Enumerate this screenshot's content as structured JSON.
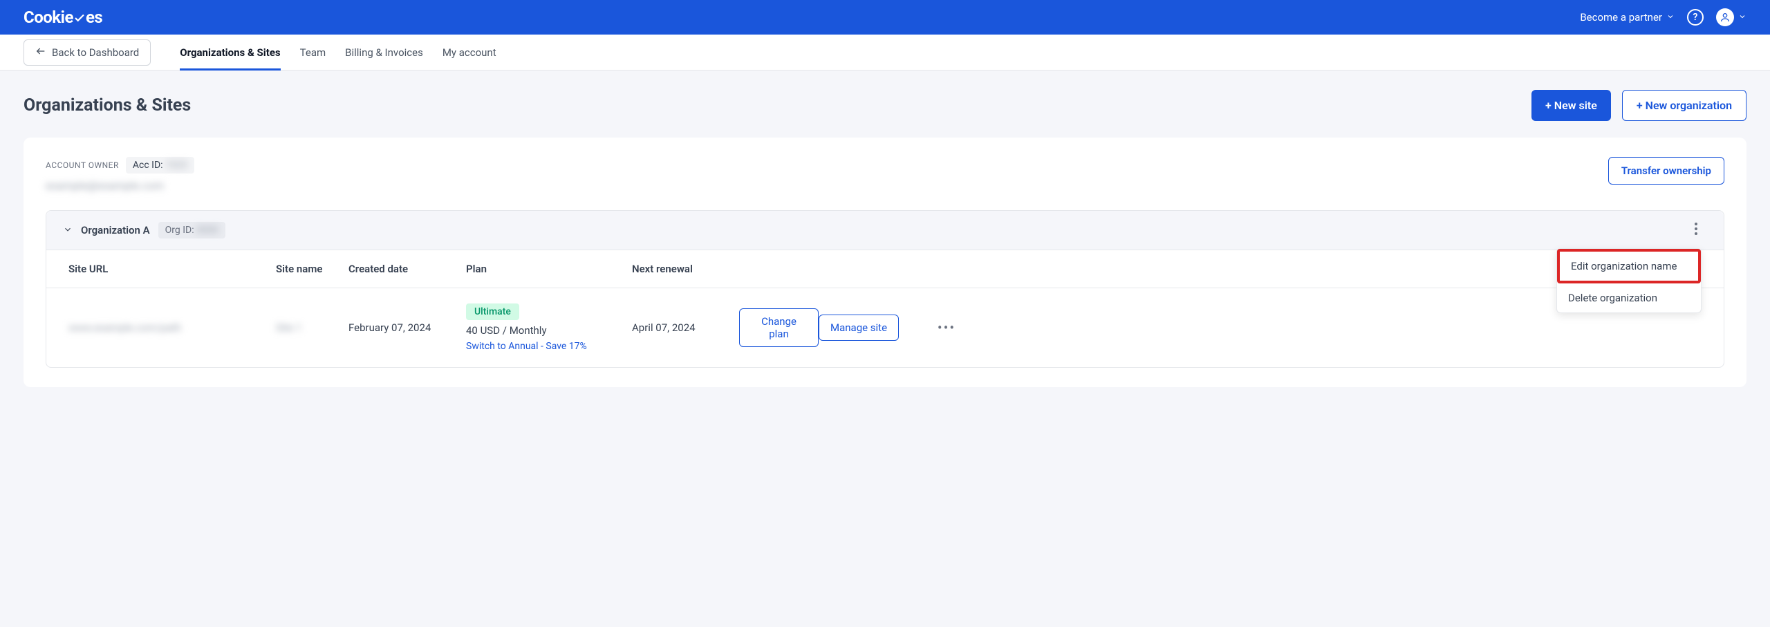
{
  "header": {
    "logo": "CookieYes",
    "partner_label": "Become a partner",
    "help_icon_text": "?"
  },
  "nav": {
    "back_label": "Back to Dashboard",
    "tabs": [
      {
        "label": "Organizations & Sites",
        "active": true
      },
      {
        "label": "Team",
        "active": false
      },
      {
        "label": "Billing & Invoices",
        "active": false
      },
      {
        "label": "My account",
        "active": false
      }
    ]
  },
  "page": {
    "title": "Organizations & Sites",
    "new_site_label": "+ New site",
    "new_org_label": "+ New organization"
  },
  "owner": {
    "label": "ACCOUNT OWNER",
    "acc_id_label": "Acc ID:",
    "acc_id_value": "1523",
    "email": "example@example.com",
    "transfer_label": "Transfer ownership"
  },
  "org": {
    "name": "Organization A",
    "id_label": "Org ID:",
    "id_value": "0000"
  },
  "table": {
    "headers": {
      "url": "Site URL",
      "name": "Site name",
      "created": "Created date",
      "plan": "Plan",
      "renewal": "Next renewal"
    },
    "row": {
      "url": "www.example.com/path",
      "name": "Site 1",
      "created": "February 07, 2024",
      "plan_badge": "Ultimate",
      "plan_price": "40 USD / Monthly",
      "switch_label": "Switch to Annual - Save 17%",
      "renewal": "April 07, 2024",
      "change_plan_label": "Change plan",
      "manage_label": "Manage site"
    }
  },
  "dropdown": {
    "edit": "Edit organization name",
    "delete": "Delete organization"
  }
}
